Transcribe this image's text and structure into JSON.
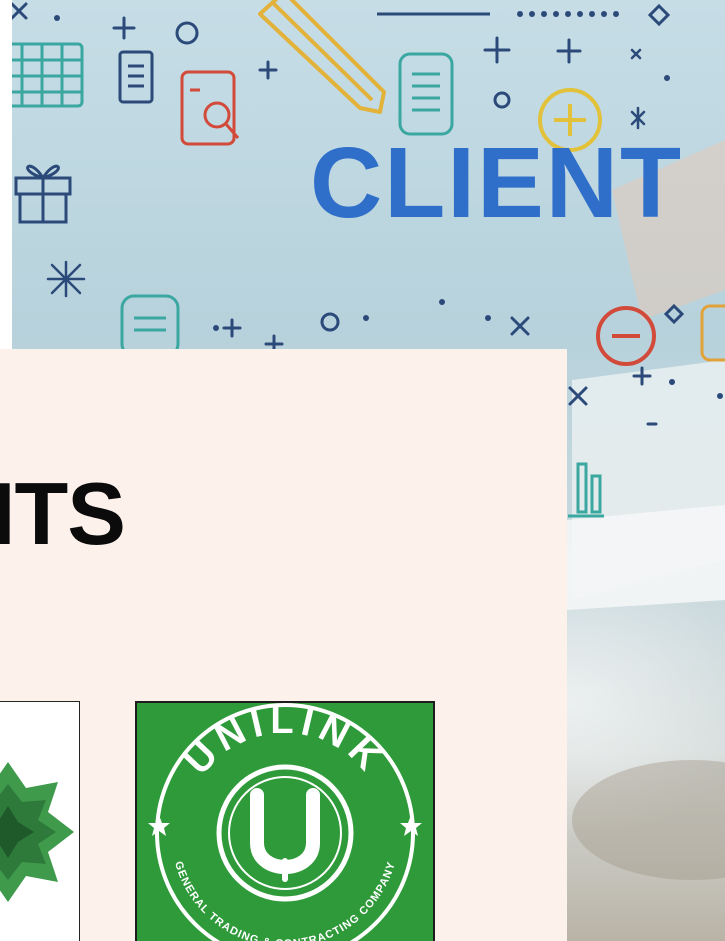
{
  "hero": {
    "word": "CLIENT",
    "icons": [
      "close-icon",
      "plus-icon",
      "circle-icon",
      "pencil-icon",
      "calendar-icon",
      "document-icon",
      "phone-search-icon",
      "notepad-icon",
      "plus-circle-icon",
      "sparkle-icon",
      "gift-icon",
      "minus-circle-icon",
      "chart-icon",
      "diamond-icon"
    ]
  },
  "panel": {
    "title": "CLIENTS"
  },
  "logos": {
    "left": {
      "name": "green-star-logo"
    },
    "right": {
      "name": "unilink-logo",
      "brand": "UNILINK",
      "tagline": "GENERAL TRADING & CONTRACTING COMPANY",
      "monogram": "U"
    }
  },
  "colors": {
    "panel_bg": "#fdf1ec",
    "hero_blue": "#2f6fc9",
    "logo_green": "#2f9a3a"
  }
}
